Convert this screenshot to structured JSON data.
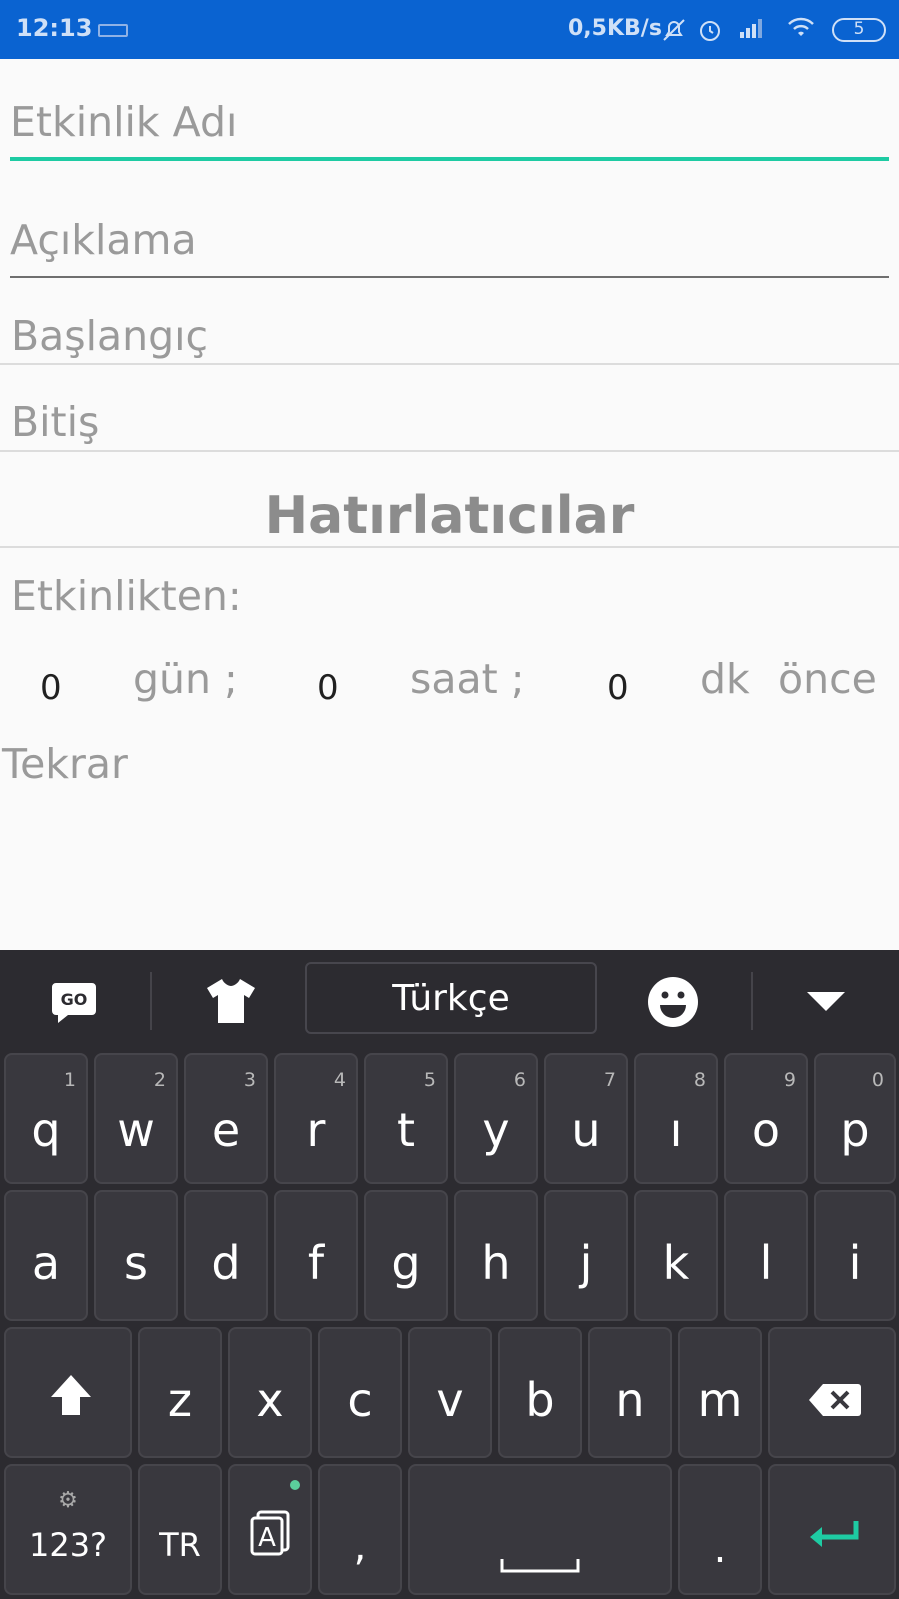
{
  "status_bar": {
    "time": "12:13",
    "network_speed": "0,5KB/s",
    "battery_level": "5",
    "icons": [
      "keyboard-icon",
      "mute-icon",
      "alarm-icon",
      "signal-icon",
      "wifi-icon",
      "battery-icon"
    ]
  },
  "form": {
    "event_name_placeholder": "Etkinlik Adı",
    "description_placeholder": "Açıklama",
    "start_label": "Başlangıç",
    "end_label": "Bitiş",
    "reminders_heading": "Hatırlatıcılar",
    "from_event_label": "Etkinlikten:",
    "reminder": {
      "days_value": "0",
      "days_unit": "gün ;",
      "hours_value": "0",
      "hours_unit": "saat ;",
      "minutes_value": "0",
      "minutes_unit": "dk",
      "before_label": "önce"
    },
    "repeat_label": "Tekrar"
  },
  "keyboard": {
    "language_label": "Türkçe",
    "toolbar_icons": [
      "go-logo-icon",
      "theme-shirt-icon",
      "emoji-icon",
      "collapse-keyboard-icon"
    ],
    "row1": [
      {
        "key": "q",
        "sub": "1"
      },
      {
        "key": "w",
        "sub": "2"
      },
      {
        "key": "e",
        "sub": "3"
      },
      {
        "key": "r",
        "sub": "4"
      },
      {
        "key": "t",
        "sub": "5"
      },
      {
        "key": "y",
        "sub": "6"
      },
      {
        "key": "u",
        "sub": "7"
      },
      {
        "key": "ı",
        "sub": "8"
      },
      {
        "key": "o",
        "sub": "9"
      },
      {
        "key": "p",
        "sub": "0"
      }
    ],
    "row2": [
      "a",
      "s",
      "d",
      "f",
      "g",
      "h",
      "j",
      "k",
      "l",
      "i"
    ],
    "row3": [
      "z",
      "x",
      "c",
      "v",
      "b",
      "n",
      "m"
    ],
    "symbols_key": "123?",
    "lang_key": "TR",
    "comma_key": ",",
    "period_key": ".",
    "accent_color": "#1ecba3"
  }
}
